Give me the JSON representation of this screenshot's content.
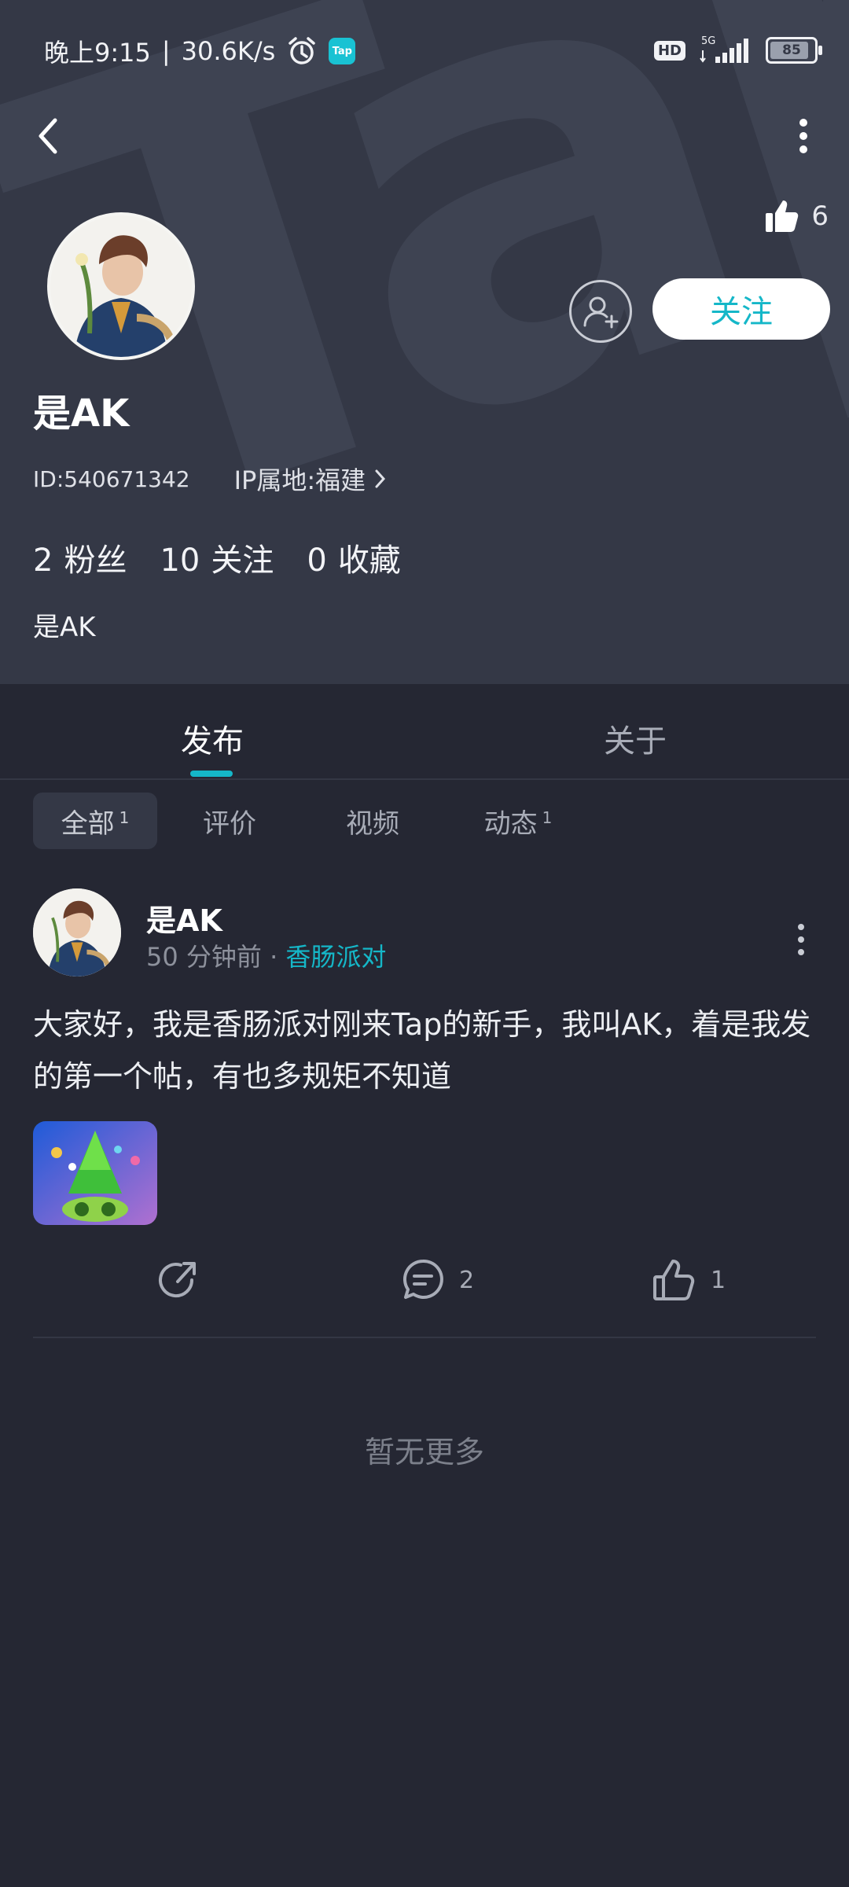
{
  "status_bar": {
    "time": "晚上9:15",
    "speed": "30.6K/s",
    "network": "5G",
    "hd": "HD",
    "battery": "85",
    "tap_badge": "Tap",
    "icons": [
      "alarm-icon",
      "tap-app-icon",
      "signal-icon",
      "battery-icon"
    ]
  },
  "header": {
    "watermark": "TapTap",
    "likes_count": "6",
    "follow_label": "关注",
    "username": "是AK",
    "id_text": "ID:540671342",
    "ip_text": "IP属地:福建",
    "stats": [
      {
        "num": "2",
        "label": "粉丝"
      },
      {
        "num": "10",
        "label": "关注"
      },
      {
        "num": "0",
        "label": "收藏"
      }
    ],
    "bio": "是AK",
    "colors": {
      "accent": "#15b7c8",
      "header_bg": "#343846",
      "page_bg": "#252733"
    }
  },
  "tabs": [
    {
      "label": "发布",
      "active": true
    },
    {
      "label": "关于",
      "active": false
    }
  ],
  "chips": [
    {
      "label": "全部",
      "count": "1",
      "active": true
    },
    {
      "label": "评价",
      "count": ""
    },
    {
      "label": "视频",
      "count": ""
    },
    {
      "label": "动态",
      "count": "1"
    }
  ],
  "post": {
    "author": "是AK",
    "time_ago": "50 分钟前",
    "separator": "·",
    "game": "香肠派对",
    "content": "大家好，我是香肠派对刚来Tap的新手，我叫AK，着是我发的第一个帖，有也多规矩不知道",
    "comment_count": "2",
    "like_count": "1"
  },
  "footer": {
    "no_more": "暂无更多"
  }
}
